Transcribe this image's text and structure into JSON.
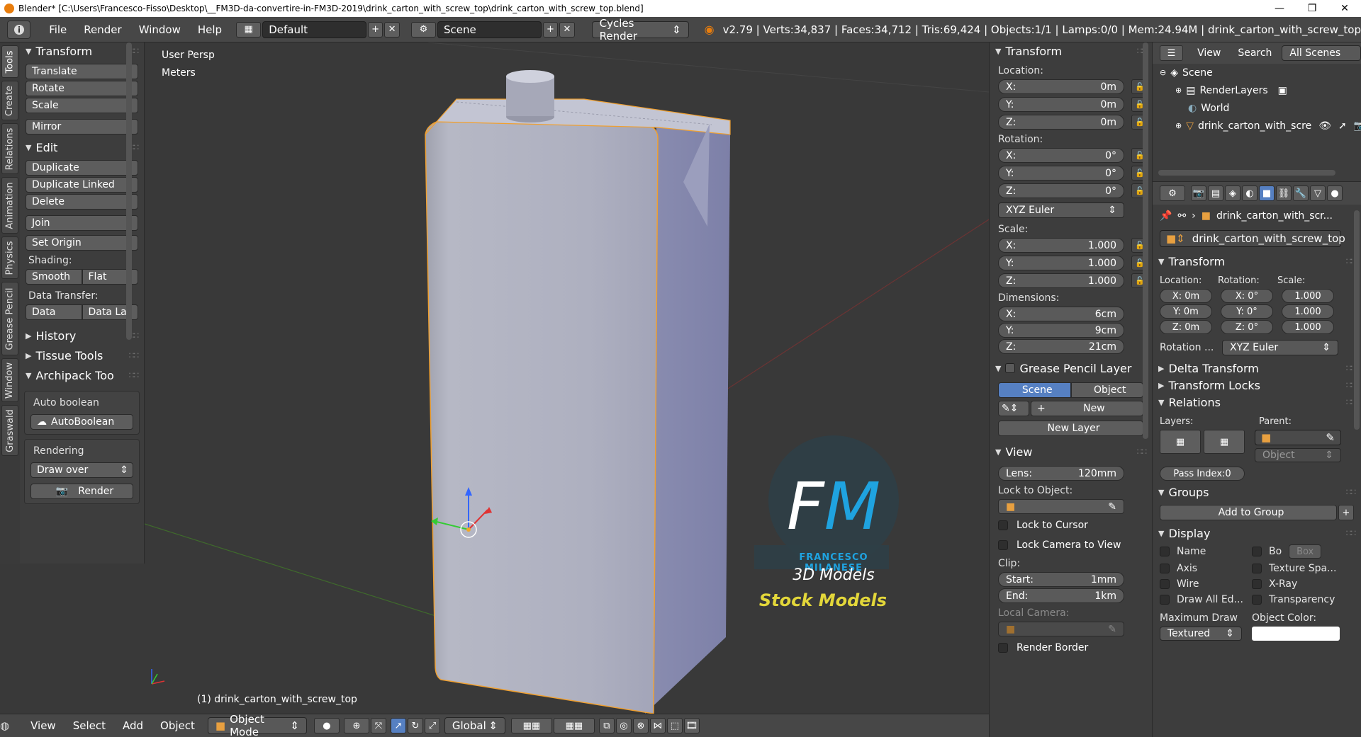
{
  "window": {
    "title": "Blender* [C:\\Users\\Francesco-Fisso\\Desktop\\__FM3D-da-convertire-in-FM3D-2019\\drink_carton_with_screw_top\\drink_carton_with_screw_top.blend]",
    "minimize": "—",
    "maximize": "❐",
    "close": "✕"
  },
  "info": {
    "menus": [
      "File",
      "Render",
      "Window",
      "Help"
    ],
    "screen_layout": "Default",
    "scene": "Scene",
    "render_engine": "Cycles Render",
    "stats": "v2.79 | Verts:34,837 | Faces:34,712 | Tris:69,424 | Objects:1/1 | Lamps:0/0 | Mem:24.94M | drink_carton_with_screw_top"
  },
  "tabs": [
    "Tools",
    "Create",
    "Relations",
    "Animation",
    "Physics",
    "Grease Pencil",
    "Window",
    "Graswald"
  ],
  "toolshelf": {
    "transform_title": "Transform",
    "translate": "Translate",
    "rotate": "Rotate",
    "scale": "Scale",
    "mirror": "Mirror",
    "edit_title": "Edit",
    "duplicate": "Duplicate",
    "duplicate_linked": "Duplicate Linked",
    "delete": "Delete",
    "join": "Join",
    "set_origin": "Set Origin",
    "shading_label": "Shading:",
    "smooth": "Smooth",
    "flat": "Flat",
    "data_transfer_label": "Data Transfer:",
    "data": "Data",
    "data_layers": "Data La",
    "history_title": "History",
    "tissue_title": "Tissue Tools",
    "archipack_title": "Archipack Too",
    "auto_boolean_label": "Auto boolean",
    "auto_boolean_btn": "AutoBoolean",
    "rendering_label": "Rendering",
    "draw_over": "Draw over",
    "render_btn": "Render"
  },
  "viewport": {
    "view_name": "User Persp",
    "units": "Meters",
    "object_label": "(1) drink_carton_with_screw_top",
    "watermark_initials": "FM",
    "watermark_name": "FRANCESCO MILANESE",
    "watermark_sub": "3D Models",
    "watermark_banner": "Stock Models"
  },
  "bottombar": {
    "view": "View",
    "select": "Select",
    "add": "Add",
    "object": "Object",
    "mode": "Object Mode",
    "orientation": "Global"
  },
  "npanel": {
    "transform_title": "Transform",
    "location_label": "Location:",
    "loc": [
      {
        "k": "X:",
        "v": "0m"
      },
      {
        "k": "Y:",
        "v": "0m"
      },
      {
        "k": "Z:",
        "v": "0m"
      }
    ],
    "rotation_label": "Rotation:",
    "rot": [
      {
        "k": "X:",
        "v": "0°"
      },
      {
        "k": "Y:",
        "v": "0°"
      },
      {
        "k": "Z:",
        "v": "0°"
      }
    ],
    "rotation_mode": "XYZ Euler",
    "scale_label": "Scale:",
    "scl": [
      {
        "k": "X:",
        "v": "1.000"
      },
      {
        "k": "Y:",
        "v": "1.000"
      },
      {
        "k": "Z:",
        "v": "1.000"
      }
    ],
    "dimensions_label": "Dimensions:",
    "dim": [
      {
        "k": "X:",
        "v": "6cm"
      },
      {
        "k": "Y:",
        "v": "9cm"
      },
      {
        "k": "Z:",
        "v": "21cm"
      }
    ],
    "gp_title": "Grease Pencil Layer",
    "gp_scene": "Scene",
    "gp_object": "Object",
    "gp_new": "New",
    "gp_new_layer": "New Layer",
    "view_title": "View",
    "lens_k": "Lens:",
    "lens_v": "120mm",
    "lock_to_object": "Lock to Object:",
    "lock_to_cursor": "Lock to Cursor",
    "lock_camera": "Lock Camera to View",
    "clip_label": "Clip:",
    "clip_start_k": "Start:",
    "clip_start_v": "1mm",
    "clip_end_k": "End:",
    "clip_end_v": "1km",
    "local_camera": "Local Camera:",
    "render_border": "Render Border"
  },
  "outliner": {
    "view": "View",
    "search": "Search",
    "all_scenes": "All Scenes",
    "items": [
      "Scene",
      "RenderLayers",
      "World",
      "drink_carton_with_scre"
    ]
  },
  "properties": {
    "context_name": "drink_carton_with_scr...",
    "object_name": "drink_carton_with_screw_top",
    "transform_title": "Transform",
    "location_label": "Location:",
    "rotation_label": "Rotation:",
    "scale_label": "Scale:",
    "loc": [
      "X: 0m",
      "Y: 0m",
      "Z: 0m"
    ],
    "rot": [
      "X:  0°",
      "Y:  0°",
      "Z:  0°"
    ],
    "scl": [
      "1.000",
      "1.000",
      "1.000"
    ],
    "rotation_mode_label": "Rotation ...",
    "rotation_mode": "XYZ Euler",
    "delta_transform": "Delta Transform",
    "transform_locks": "Transform Locks",
    "relations_title": "Relations",
    "layers_label": "Layers:",
    "parent_label": "Parent:",
    "parent_type": "Object",
    "pass_index": "Pass Index:0",
    "groups_title": "Groups",
    "add_to_group": "Add to Group",
    "display_title": "Display",
    "name": "Name",
    "bounds": "Bo",
    "bounds_type": "Box",
    "axis": "Axis",
    "texture_space": "Texture Spa...",
    "wire": "Wire",
    "xray": "X-Ray",
    "draw_all_edges": "Draw All Ed...",
    "transparency": "Transparency",
    "max_draw_label": "Maximum Draw",
    "max_draw": "Textured",
    "object_color_label": "Object Color:"
  },
  "colors": {
    "accent_blue": "#5680c2",
    "selection_orange": "#f5a623",
    "watermark_blue": "#1fa3e0",
    "watermark_banner": "#e3d73a"
  }
}
